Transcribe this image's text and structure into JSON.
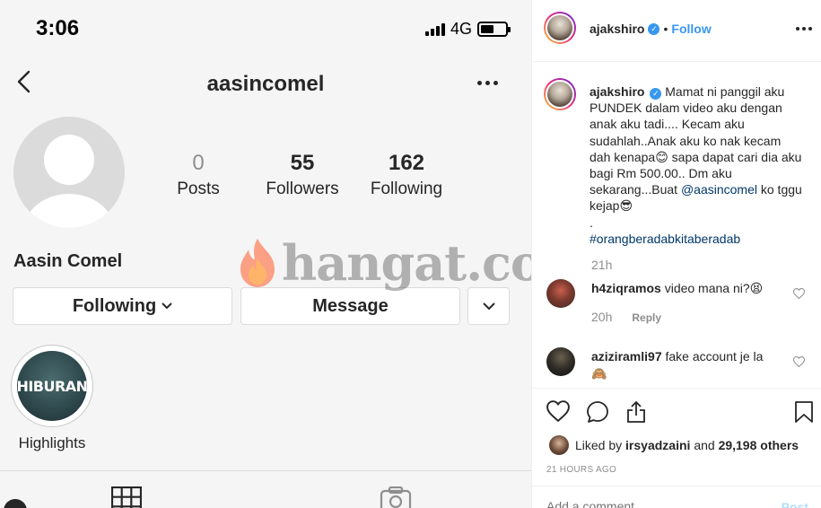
{
  "status_bar": {
    "time": "3:06",
    "network": "4G",
    "battery_level": 0.55
  },
  "profile": {
    "username": "aasincomel",
    "display_name": "Aasin Comel",
    "stats": {
      "posts": {
        "count": "0",
        "label": "Posts"
      },
      "followers": {
        "count": "55",
        "label": "Followers"
      },
      "following": {
        "count": "162",
        "label": "Following"
      }
    },
    "buttons": {
      "following": "Following",
      "message": "Message"
    },
    "highlight": {
      "cover_text": "HIBURAN",
      "label": "Highlights"
    }
  },
  "watermark": {
    "text": "hangat.com"
  },
  "post": {
    "author": "ajakshiro",
    "follow_label": "Follow",
    "caption": {
      "text_before_mention": "Mamat ni panggil aku PUNDEK dalam video aku dengan anak aku tadi.... Kecam aku sudahlah..Anak aku ko nak kecam dah kenapa",
      "emoji_1": "😊",
      "text_mid": " sapa dapat cari dia aku bagi Rm 500.00.. Dm aku sekarang...Buat ",
      "mention": "@aasincomel",
      "text_after_mention": " ko tggu kejap",
      "emoji_2": "😎",
      "dot": ".",
      "hashtag": "#orangberadabkitaberadab"
    },
    "caption_time": "21h",
    "comments": [
      {
        "username": "h4ziqramos",
        "text": "video mana ni?",
        "emoji": "😫",
        "time": "20h",
        "reply_label": "Reply"
      },
      {
        "username": "aziziramli97",
        "text": "fake account je la",
        "emoji": "🙈"
      }
    ],
    "likes": {
      "prefix": "Liked by",
      "user": "irsyadzaini",
      "middle": "and",
      "count": "29,198 others"
    },
    "timestamp": "21 HOURS AGO",
    "add_comment_placeholder": "Add a comment...",
    "post_label": "Post"
  }
}
